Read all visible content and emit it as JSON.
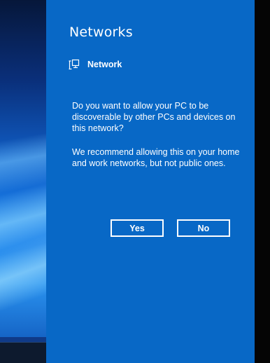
{
  "flyout": {
    "title": "Networks",
    "network_name": "Network",
    "network_icon": "network-pc-icon",
    "question": "Do you want to allow your PC to be discoverable by other PCs and devices on this network?",
    "recommendation": "We recommend allowing this on your home and work networks, but not public ones.",
    "yes_label": "Yes",
    "no_label": "No",
    "background_color": "#0868c6"
  }
}
